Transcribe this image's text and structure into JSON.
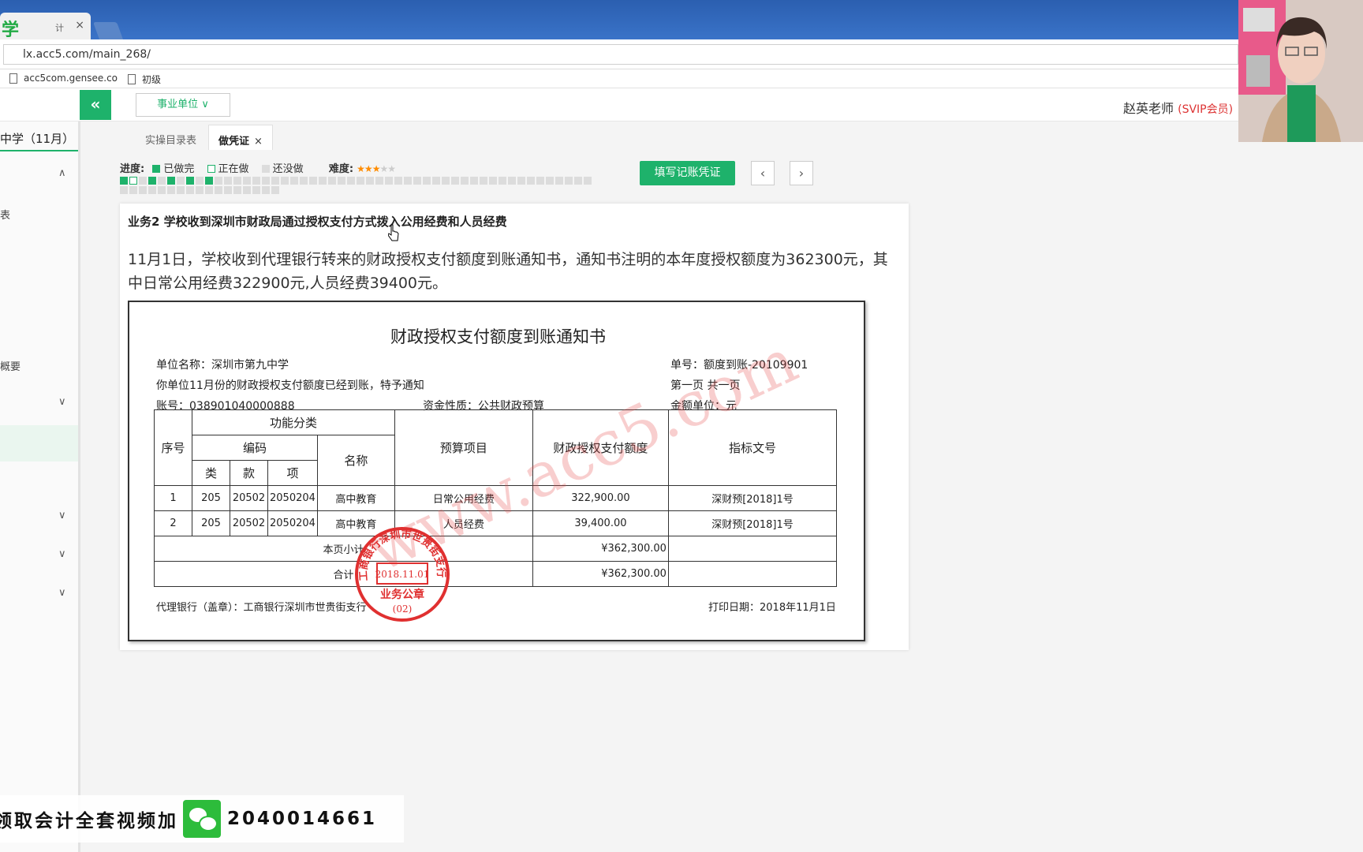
{
  "browser": {
    "tab_title": "计",
    "tab_close": "×",
    "url": "lx.acc5.com/main_268/",
    "bookmarks": [
      "acc5com.gensee.co",
      "初级"
    ]
  },
  "header": {
    "collapse_icon": "«",
    "unit_select": "事业单位",
    "unit_chevron": "∨",
    "user": "赵英老师",
    "vip": "(SVIP会员)"
  },
  "sidebar": {
    "title": "中学（11月）",
    "items": [
      "表",
      "概要"
    ],
    "chevrons": [
      "∧",
      "∨",
      "∨",
      "∨",
      "∨"
    ]
  },
  "content_tabs": [
    {
      "label": "实操目录表",
      "active": false
    },
    {
      "label": "做凭证",
      "active": true,
      "close": "×"
    }
  ],
  "progress": {
    "label": "进度:",
    "done": "已做完",
    "doing": "正在做",
    "todo": "还没做",
    "difficulty_label": "难度:",
    "difficulty": 3,
    "difficulty_max": 5,
    "colors": {
      "done": "#1eb26b",
      "todo": "#dcdcdc"
    }
  },
  "actions": {
    "fill_voucher": "填写记账凭证",
    "prev": "‹",
    "next": "›"
  },
  "task": {
    "title": "业务2 学校收到深圳市财政局通过授权支付方式拨入公用经费和人员经费",
    "description": "11月1日，学校收到代理银行转来的财政授权支付额度到账通知书，通知书注明的本年度授权额度为362300元，其中日常公用经费322900元,人员经费39400元。"
  },
  "document": {
    "title": "财政授权支付额度到账通知书",
    "unit_name": "单位名称：深圳市第九中学",
    "doc_no": "单号：额度到账-20109901",
    "notice": "你单位11月份的财政授权支付额度已经到账，特予通知",
    "page": "第一页   共一页",
    "account": "账号：038901040000888",
    "fund_nature": "资金性质：公共财政预算",
    "amount_unit": "金额单位：元",
    "headers": {
      "seq": "序号",
      "func": "功能分类",
      "code": "编码",
      "name": "名称",
      "lei": "类",
      "kuan": "款",
      "xiang": "项",
      "budget_item": "预算项目",
      "amount": "财政授权支付额度",
      "index_no": "指标文号"
    },
    "rows": [
      {
        "seq": "1",
        "lei": "205",
        "kuan": "20502",
        "xiang": "2050204",
        "name": "高中教育",
        "item": "日常公用经费",
        "amount": "322,900.00",
        "index": "深财预[2018]1号"
      },
      {
        "seq": "2",
        "lei": "205",
        "kuan": "20502",
        "xiang": "2050204",
        "name": "高中教育",
        "item": "人员经费",
        "amount": "39,400.00",
        "index": "深财预[2018]1号"
      }
    ],
    "subtotal_label": "本页小计",
    "subtotal": "¥362,300.00",
    "total_label": "合计",
    "total": "¥362,300.00",
    "bank": "代理银行（盖章）：工商银行深圳市世贵街支行",
    "print_date": "打印日期：2018年11月1日",
    "watermark": "www.acc5.com",
    "stamp": {
      "ring": "工商银行深圳市世贵街支行",
      "date": "2018.11.01",
      "seal": "业务公章",
      "code": "(02)",
      "color": "#e03030"
    }
  },
  "banner": {
    "text": "领取会计全套视频加",
    "number": "2040014661"
  }
}
